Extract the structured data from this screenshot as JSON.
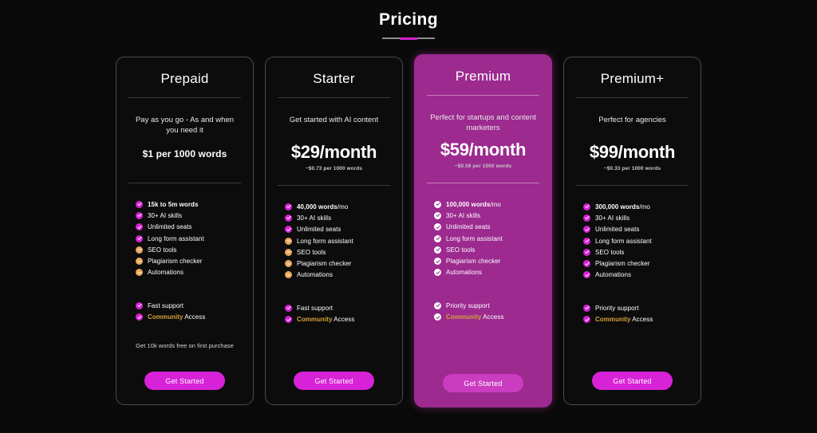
{
  "header": {
    "title": "Pricing",
    "accent_color": "#cc22cc",
    "rule_color": "#8d8d8d"
  },
  "colors": {
    "page_background": "#0a0a0a",
    "card_background": "#0c0c0c",
    "card_border": "#4a4a4a",
    "featured_background": "#9c2a8f",
    "check_magenta": "#d722d7",
    "dash_orange": "#e8a85c",
    "community_gold": "#d8a13a",
    "cta_magenta": "#d722d7",
    "cta_featured": "#cb3dc0"
  },
  "plans": [
    {
      "name": "Prepaid",
      "featured": false,
      "tagline": "Pay as you go - As and when you need it",
      "price": "$1 per 1000 words",
      "price_small": true,
      "price_note": "",
      "features": [
        {
          "label": "15k to 5m words",
          "bold": true,
          "state": "included"
        },
        {
          "label": "30+ AI skills",
          "bold": false,
          "state": "included"
        },
        {
          "label": "Unlimited seats",
          "bold": false,
          "state": "included"
        },
        {
          "label": "Long form assistant",
          "bold": false,
          "state": "included"
        },
        {
          "label": "SEO tools",
          "bold": false,
          "state": "excluded"
        },
        {
          "label": "Plagiarism checker",
          "bold": false,
          "state": "excluded"
        },
        {
          "label": "Automations",
          "bold": false,
          "state": "excluded"
        }
      ],
      "support": [
        {
          "label": "Fast support",
          "state": "included",
          "style": "plain"
        },
        {
          "label": "Community Access",
          "state": "included",
          "style": "community"
        }
      ],
      "footnote": "Get 10k words free on first purchase",
      "cta_label": "Get Started"
    },
    {
      "name": "Starter",
      "featured": false,
      "tagline": "Get started with AI content",
      "price": "$29/month",
      "price_small": false,
      "price_note": "~$0.73 per 1000 words",
      "features": [
        {
          "label": "40,000 words",
          "suffix": "/mo",
          "bold": true,
          "state": "included"
        },
        {
          "label": "30+ AI skills",
          "bold": false,
          "state": "included"
        },
        {
          "label": "Unlimited seats",
          "bold": false,
          "state": "included"
        },
        {
          "label": "Long form assistant",
          "bold": false,
          "state": "excluded"
        },
        {
          "label": "SEO tools",
          "bold": false,
          "state": "excluded"
        },
        {
          "label": "Plagiarism checker",
          "bold": false,
          "state": "excluded"
        },
        {
          "label": "Automations",
          "bold": false,
          "state": "excluded"
        }
      ],
      "support": [
        {
          "label": "Fast support",
          "state": "included",
          "style": "plain"
        },
        {
          "label": "Community Access",
          "state": "included",
          "style": "community"
        }
      ],
      "footnote": "",
      "cta_label": "Get Started"
    },
    {
      "name": "Premium",
      "featured": true,
      "tagline": "Perfect for startups and content marketers",
      "price": "$59/month",
      "price_small": false,
      "price_note": "~$0.59 per 1000 words",
      "features": [
        {
          "label": "100,000 words",
          "suffix": "/mo",
          "bold": true,
          "state": "included"
        },
        {
          "label": "30+ AI skills",
          "bold": false,
          "state": "included"
        },
        {
          "label": "Unlimited seats",
          "bold": false,
          "state": "included"
        },
        {
          "label": "Long form assistant",
          "bold": false,
          "state": "included"
        },
        {
          "label": "SEO tools",
          "bold": false,
          "state": "included"
        },
        {
          "label": "Plagiarism checker",
          "bold": false,
          "state": "included"
        },
        {
          "label": "Automations",
          "bold": false,
          "state": "included"
        }
      ],
      "support": [
        {
          "label": "Priority support",
          "state": "included",
          "style": "plain"
        },
        {
          "label": "Community Access",
          "state": "included",
          "style": "community"
        }
      ],
      "footnote": "",
      "cta_label": "Get Started"
    },
    {
      "name": "Premium+",
      "featured": false,
      "tagline": "Perfect for agencies",
      "price": "$99/month",
      "price_small": false,
      "price_note": "~$0.33 per 1000 words",
      "features": [
        {
          "label": "300,000 words",
          "suffix": "/mo",
          "bold": true,
          "state": "included"
        },
        {
          "label": "30+ AI skills",
          "bold": false,
          "state": "included"
        },
        {
          "label": "Unlimited seats",
          "bold": false,
          "state": "included"
        },
        {
          "label": "Long form assistant",
          "bold": false,
          "state": "included"
        },
        {
          "label": "SEO tools",
          "bold": false,
          "state": "included"
        },
        {
          "label": "Plagiarism checker",
          "bold": false,
          "state": "included"
        },
        {
          "label": "Automations",
          "bold": false,
          "state": "included"
        }
      ],
      "support": [
        {
          "label": "Priority support",
          "state": "included",
          "style": "plain"
        },
        {
          "label": "Community Access",
          "state": "included",
          "style": "community"
        }
      ],
      "footnote": "",
      "cta_label": "Get Started"
    }
  ]
}
